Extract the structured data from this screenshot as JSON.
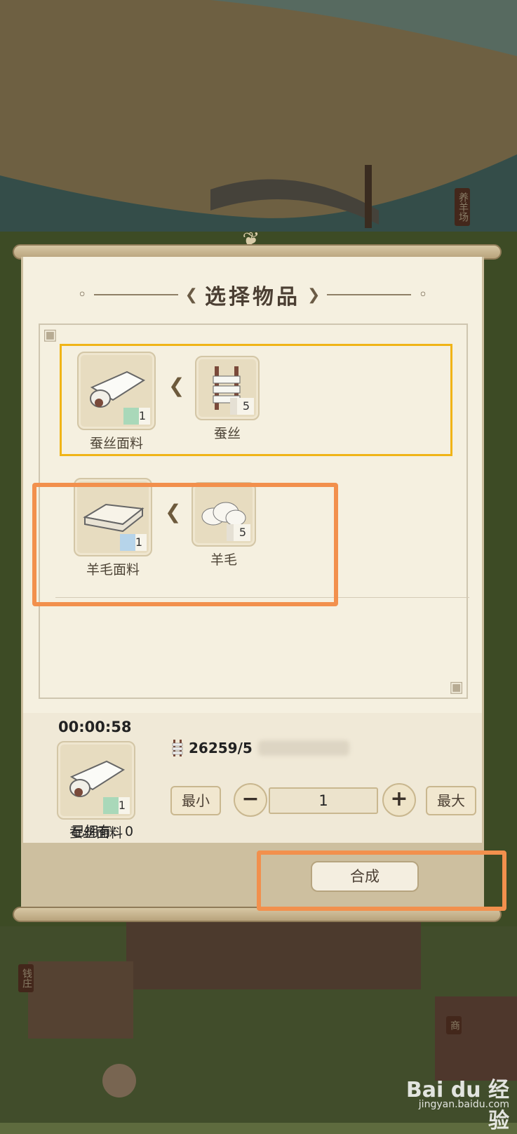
{
  "map": {
    "sheep_farm_sign": "养羊场",
    "bank_sign": "钱庄",
    "shop_sign": "商"
  },
  "dialog": {
    "title": "选择物品",
    "recipes": [
      {
        "product": {
          "name": "蚕丝面料",
          "count": "1",
          "icon": "silk-fabric-icon"
        },
        "ingredient": {
          "name": "蚕丝",
          "count": "5",
          "icon": "silk-thread-icon"
        },
        "selected": true
      },
      {
        "product": {
          "name": "羊毛面料",
          "count": "1",
          "icon": "wool-fabric-icon"
        },
        "ingredient": {
          "name": "羊毛",
          "count": "5",
          "icon": "wool-icon"
        },
        "selected": false
      }
    ],
    "timer": "00:00:58",
    "selected_product": {
      "name": "蚕丝面料",
      "count": "1"
    },
    "owned_label": "已拥有：0",
    "stock": "26259/5",
    "min_label": "最小",
    "max_label": "最大",
    "minus_symbol": "−",
    "plus_symbol": "+",
    "quantity": "1",
    "craft_label": "合成"
  },
  "watermark": {
    "logo": "Bai du 经验",
    "url": "jingyan.baidu.com"
  },
  "colors": {
    "selected_border": "#f0b417",
    "annotation": "#f2904d",
    "panel_bg": "#f5f0e0"
  }
}
